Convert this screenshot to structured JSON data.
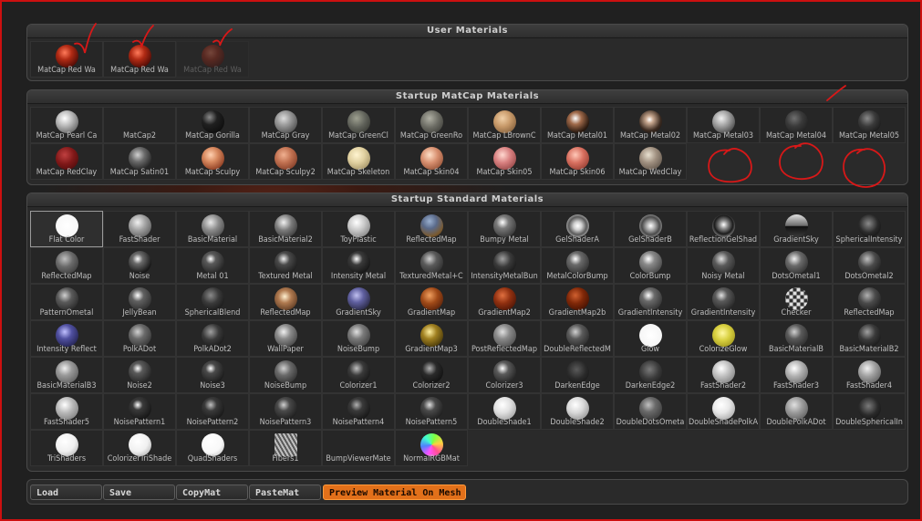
{
  "colors": {
    "frame_border": "#cc1010",
    "annotation": "#d81818",
    "preview_button": "#e2701a"
  },
  "user_materials": {
    "title": "User Materials",
    "items": [
      {
        "label": "MatCap  Red  Wa",
        "ball": "radial-gradient(circle at 40% 35%,#ff7a5a 0%,#b02a14 35%,#4a0a05 80%,#1a0000 100%)"
      },
      {
        "label": "MatCap  Red  Wa",
        "ball": "radial-gradient(circle at 40% 35%,#ff7a5a 0%,#b02a14 35%,#4a0a05 80%,#1a0000 100%)"
      },
      {
        "label": "MatCap  Red  Wa",
        "ball": "radial-gradient(circle at 40% 35%,#ff7a5a 0%,#b02a14 35%,#4a0a05 80%,#1a0000 100%)",
        "faded": true
      }
    ]
  },
  "startup_matcap": {
    "title": "Startup MatCap Materials",
    "items": [
      {
        "label": "MatCap  Pearl  Ca",
        "ball": "radial-gradient(circle at 40% 35%,#ffffff 0%,#c8c8c8 30%,#707070 75%,#303030 100%)"
      },
      {
        "label": "MatCap2",
        "ball": "radial-gradient(circle at 50% 50%,#262626 0%,#262626 100%)"
      },
      {
        "label": "MatCap  Gorilla",
        "ball": "radial-gradient(circle at 35% 30%,#8a8a8a 0%,#202020 35%,#050505 100%)"
      },
      {
        "label": "MatCap  Gray",
        "ball": "radial-gradient(circle at 40% 35%,#dcdcdc 0%,#9a9a9a 35%,#505050 80%,#262626 100%)"
      },
      {
        "label": "MatCap  GreenCl",
        "ball": "radial-gradient(circle at 40% 35%,#9ea090 0%,#60625a 45%,#2a2b26 100%)"
      },
      {
        "label": "MatCap  GreenRo",
        "ball": "radial-gradient(circle at 40% 35%,#b0b0a4 0%,#6c6c64 45%,#2e2e2a 100%)"
      },
      {
        "label": "MatCap  LBrownC",
        "ball": "radial-gradient(circle at 40% 35%,#f0d0a8 0%,#c89a6a 40%,#6a4a2a 100%)"
      },
      {
        "label": "MatCap  Metal01",
        "ball": "radial-gradient(circle at 40% 35%,#ffffff 0%,#a06a4a 30%,#2a1a10 70%,#101010 100%)"
      },
      {
        "label": "MatCap  Metal02",
        "ball": "radial-gradient(circle at 45% 40%,#ffffff 0%,#c8a890 20%,#3a2a20 60%,#0a0a0a 100%)"
      },
      {
        "label": "MatCap  Metal03",
        "ball": "radial-gradient(circle at 40% 35%,#f0f0f0 0%,#a8a8a8 35%,#4a4a4a 80%,#202020 100%)"
      },
      {
        "label": "MatCap  Metal04",
        "ball": "radial-gradient(circle at 40% 35%,#707070 0%,#3a3a3a 40%,#141414 100%)"
      },
      {
        "label": "MatCap  Metal05",
        "ball": "radial-gradient(circle at 40% 35%,#8a8a8a 0%,#3a3a3a 40%,#0a0a0a 100%)"
      },
      {
        "label": "MatCap  RedClay",
        "ball": "radial-gradient(circle at 40% 35%,#c04040 0%,#801818 45%,#3a0808 100%)"
      },
      {
        "label": "MatCap  Satin01",
        "ball": "radial-gradient(circle at 40% 35%,#d0d0d0 0%,#6a6a6a 35%,#202020 80%,#101010 100%)"
      },
      {
        "label": "MatCap  Sculpy",
        "ball": "radial-gradient(circle at 40% 35%,#ffd0b0 0%,#d88a60 35%,#8a3a20 80%,#3a1808 100%)"
      },
      {
        "label": "MatCap  Sculpy2",
        "ball": "radial-gradient(circle at 40% 35%,#f0b090 0%,#c07050 40%,#6a2a18 100%)"
      },
      {
        "label": "MatCap  Skeleton",
        "ball": "radial-gradient(circle at 40% 35%,#fff4d0 0%,#e0d0a0 40%,#8a7a50 100%)"
      },
      {
        "label": "MatCap  Skin04",
        "ball": "radial-gradient(circle at 40% 35%,#ffe0c8 0%,#d89070 40%,#7a3a20 100%)"
      },
      {
        "label": "MatCap  Skin05",
        "ball": "radial-gradient(circle at 40% 35%,#ffd8d0 0%,#d88080 40%,#7a3030 100%)"
      },
      {
        "label": "MatCap  Skin06",
        "ball": "radial-gradient(circle at 40% 35%,#ffc8b8 0%,#d87060 40%,#7a2a20 100%)"
      },
      {
        "label": "MatCap  WedClay",
        "ball": "radial-gradient(circle at 40% 35%,#e8e0d0 0%,#a09080 40%,#4a4038 100%)"
      }
    ]
  },
  "startup_standard": {
    "title": "Startup Standard Materials",
    "items": [
      {
        "label": "Flat  Color",
        "ball": "radial-gradient(circle,#ffffff 0%,#f4f4f4 100%)",
        "selected": true
      },
      {
        "label": "FastShader",
        "ball": "radial-gradient(circle at 40% 35%,#f0f0f0 0%,#a0a0a0 40%,#404040 100%)"
      },
      {
        "label": "BasicMaterial",
        "ball": "radial-gradient(circle at 40% 35%,#e8e8e8 0%,#8a8a8a 40%,#303030 100%)"
      },
      {
        "label": "BasicMaterial2",
        "ball": "radial-gradient(circle at 40% 35%,#f0f0f0 0%,#7a7a7a 40%,#202020 100%)"
      },
      {
        "label": "ToyPlastic",
        "ball": "radial-gradient(circle at 40% 35%,#ffffff 0%,#c8c8c8 40%,#6a6a6a 100%)"
      },
      {
        "label": "ReflectedMap",
        "ball": "radial-gradient(circle at 40% 30%,#9ab0d0 0%,#5a6a8a 35%,#7a5a30 70%,#2a1a10 100%)"
      },
      {
        "label": "Bumpy  Metal",
        "ball": "radial-gradient(circle at 40% 35%,#ffffff 0%,#7a7a7a 30%,#1a1a1a 100%)"
      },
      {
        "label": "GelShaderA",
        "ball": "radial-gradient(circle at 50% 50%,#ffffff 0%,#d0d0d0 25%,#5a5a5a 55%,#c0c0c0 80%,#303030 100%)"
      },
      {
        "label": "GelShaderB",
        "ball": "radial-gradient(circle at 50% 50%,#ffffff 0%,#b0b0b0 25%,#4a4a4a 55%,#a0a0a0 80%,#202020 100%)"
      },
      {
        "label": "ReflectionGelShad",
        "ball": "radial-gradient(circle at 50% 45%,#ffffff 0%,#8a8a8a 25%,#1a1a1a 55%,#9a9a9a 80%,#202020 100%)"
      },
      {
        "label": "GradientSky",
        "ball": "linear-gradient(#e0e0e0 0%,#6a6a6a 50%,#101010 52%,#3a3a3a 100%)"
      },
      {
        "label": "SphericalIntensity",
        "ball": "radial-gradient(circle at 45% 40%,#8a8a8a 0%,#2a2a2a 50%,#0a0a0a 100%)"
      },
      {
        "label": "ReflectedMap",
        "ball": "radial-gradient(circle at 40% 35%,#c0c0c0 0%,#6a6a6a 40%,#2a2a2a 100%)"
      },
      {
        "label": "Noise",
        "ball": "radial-gradient(circle at 40% 35%,#ffffff 0%,#6a6a6a 25%,#1a1a1a 70%,#0a0a0a 100%)"
      },
      {
        "label": "Metal  01",
        "ball": "radial-gradient(circle at 40% 35%,#ffffff 0%,#5a5a5a 25%,#0a0a0a 100%)"
      },
      {
        "label": "Textured  Metal",
        "ball": "radial-gradient(circle at 40% 35%,#f0f0f0 0%,#4a4a4a 30%,#080808 100%)"
      },
      {
        "label": "Intensity  Metal",
        "ball": "radial-gradient(circle at 40% 35%,#ffffff 0%,#3a3a3a 30%,#050505 100%)"
      },
      {
        "label": "TexturedMetal+C",
        "ball": "radial-gradient(circle at 40% 35%,#d0d0d0 0%,#5a5a5a 35%,#1a1a1a 100%)"
      },
      {
        "label": "IntensityMetalBun",
        "ball": "radial-gradient(circle at 40% 35%,#a0a0a0 0%,#3a3a3a 40%,#0a0a0a 100%)"
      },
      {
        "label": "MetalColorBump",
        "ball": "radial-gradient(circle at 40% 35%,#ffffff 0%,#6a6a6a 30%,#1a1a1a 100%)"
      },
      {
        "label": "ColorBump",
        "ball": "radial-gradient(circle at 40% 35%,#ffffff 0%,#8a8a8a 30%,#2a2a2a 100%)"
      },
      {
        "label": "Noisy  Metal",
        "ball": "radial-gradient(circle at 40% 35%,#e0e0e0 0%,#5a5a5a 35%,#1a1a1a 100%)"
      },
      {
        "label": "DotsOmetal1",
        "ball": "radial-gradient(circle at 40% 35%,#f0f0f0 0%,#6a6a6a 35%,#1a1a1a 100%)"
      },
      {
        "label": "DotsOmetal2",
        "ball": "radial-gradient(circle at 40% 35%,#c0c0c0 0%,#4a4a4a 40%,#101010 100%)"
      },
      {
        "label": "PatternOmetal",
        "ball": "radial-gradient(circle at 40% 35%,#d0d0d0 0%,#5a5a5a 35%,#151515 100%)"
      },
      {
        "label": "JellyBean",
        "ball": "radial-gradient(circle at 40% 35%,#ffffff 0%,#606060 30%,#1a1a1a 100%)"
      },
      {
        "label": "SphericalBlend",
        "ball": "radial-gradient(circle at 40% 35%,#8a8a8a 0%,#3a3a3a 40%,#0a0a0a 100%)"
      },
      {
        "label": "ReflectedMap",
        "ball": "radial-gradient(circle at 45% 40%,#fff0d0 0%,#b07a50 35%,#3a2010 100%)"
      },
      {
        "label": "GradientSky",
        "ball": "radial-gradient(circle at 40% 35%,#c0c0f0 0%,#6060a0 35%,#101018 100%)"
      },
      {
        "label": "GradientMap",
        "ball": "radial-gradient(circle at 40% 35%,#f0a060 0%,#a04a18 40%,#3a1005 100%)"
      },
      {
        "label": "GradientMap2",
        "ball": "radial-gradient(circle at 40% 35%,#e07040 0%,#903010 40%,#300a02 100%)"
      },
      {
        "label": "GradientMap2b",
        "ball": "radial-gradient(circle at 40% 35%,#d06030 0%,#802808 40%,#280800 100%)"
      },
      {
        "label": "GradientIntensity",
        "ball": "radial-gradient(circle at 40% 35%,#ffffff 0%,#6a6a6a 30%,#1a1a1a 100%)"
      },
      {
        "label": "GradientIntensity",
        "ball": "radial-gradient(circle at 40% 35%,#e0e0e0 0%,#5a5a5a 30%,#101010 100%)"
      },
      {
        "label": "Checker",
        "ball": "repeating-conic-gradient(#e0e0e0 0 25%,#303030 0 50%) 50%/8px 8px"
      },
      {
        "label": "ReflectedMap",
        "ball": "radial-gradient(circle at 40% 35%,#b0b0b0 0%,#4a4a4a 40%,#101010 100%)"
      },
      {
        "label": "Intensity  Reflect",
        "ball": "radial-gradient(circle at 40% 35%,#c0c0ff 0%,#5050a0 35%,#101030 100%)"
      },
      {
        "label": "PolkADot",
        "ball": "radial-gradient(circle at 40% 35%,#d0d0d0 0%,#6a6a6a 35%,#202020 100%)"
      },
      {
        "label": "PolkADot2",
        "ball": "radial-gradient(circle at 40% 35%,#a0a0a0 0%,#3a3a3a 40%,#0a0a0a 100%)"
      },
      {
        "label": "WallPaper",
        "ball": "radial-gradient(circle at 40% 35%,#f0f0f0 0%,#8a8a8a 35%,#2a2a2a 100%)"
      },
      {
        "label": "NoiseBump",
        "ball": "radial-gradient(circle at 40% 35%,#e0e0e0 0%,#7a7a7a 35%,#2a2a2a 100%)"
      },
      {
        "label": "GradientMap3",
        "ball": "radial-gradient(circle at 40% 35%,#fff0a0 0%,#a08020 35%,#201800 100%)"
      },
      {
        "label": "PostReflectedMap",
        "ball": "radial-gradient(circle at 40% 35%,#e0e0e0 0%,#8a8a8a 35%,#3a3a3a 100%)"
      },
      {
        "label": "DoubleReflectedM",
        "ball": "radial-gradient(circle at 40% 35%,#d0d0d0 0%,#5a5a5a 35%,#151515 100%)"
      },
      {
        "label": "Glow",
        "ball": "radial-gradient(circle,#ffffff 0%,#f4f4f4 80%,#c0c0c0 100%)"
      },
      {
        "label": "ColorizeGlow",
        "ball": "radial-gradient(circle at 45% 40%,#fff8a0 0%,#d8d040 40%,#8a8010 100%)"
      },
      {
        "label": "BasicMaterialB",
        "ball": "radial-gradient(circle at 40% 35%,#d0d0d0 0%,#5a5a5a 35%,#1a1a1a 100%)"
      },
      {
        "label": "BasicMaterialB2",
        "ball": "radial-gradient(circle at 40% 35%,#a0a0a0 0%,#3a3a3a 40%,#0a0a0a 100%)"
      },
      {
        "label": "BasicMaterialB3",
        "ball": "radial-gradient(circle at 40% 35%,#f0f0f0 0%,#9a9a9a 35%,#4a4a4a 100%)"
      },
      {
        "label": "Noise2",
        "ball": "radial-gradient(circle at 40% 35%,#ffffff 0%,#5a5a5a 25%,#0a0a0a 100%)"
      },
      {
        "label": "Noise3",
        "ball": "radial-gradient(circle at 40% 35%,#ffffff 0%,#4a4a4a 25%,#050505 100%)"
      },
      {
        "label": "NoiseBump",
        "ball": "radial-gradient(circle at 40% 35%,#d0d0d0 0%,#6a6a6a 35%,#1a1a1a 100%)"
      },
      {
        "label": "Colorizer1",
        "ball": "radial-gradient(circle at 40% 35%,#c0c0c0 0%,#3a3a3a 35%,#080808 100%)"
      },
      {
        "label": "Colorizer2",
        "ball": "radial-gradient(circle at 40% 35%,#b0b0b0 0%,#2a2a2a 35%,#050505 100%)"
      },
      {
        "label": "Colorizer3",
        "ball": "radial-gradient(circle at 40% 35%,#ffffff 0%,#5a5a5a 30%,#0a0a0a 100%)"
      },
      {
        "label": "DarkenEdge",
        "ball": "radial-gradient(circle at 45% 40%,#5a5a5a 0%,#2a2a2a 50%,#101010 100%)"
      },
      {
        "label": "DarkenEdge2",
        "ball": "radial-gradient(circle at 45% 40%,#7a7a7a 0%,#3a3a3a 50%,#151515 100%)"
      },
      {
        "label": "FastShader2",
        "ball": "radial-gradient(circle at 40% 35%,#ffffff 0%,#c0c0c0 40%,#6a6a6a 100%)"
      },
      {
        "label": "FastShader3",
        "ball": "radial-gradient(circle at 40% 35%,#ffffff 0%,#b0b0b0 40%,#5a5a5a 100%)"
      },
      {
        "label": "FastShader4",
        "ball": "radial-gradient(circle at 40% 35%,#f0f0f0 0%,#a0a0a0 40%,#4a4a4a 100%)"
      },
      {
        "label": "FastShader5",
        "ball": "radial-gradient(circle at 40% 35%,#ffffff 0%,#b8b8b8 40%,#6a6a6a 100%)"
      },
      {
        "label": "NoisePattern1",
        "ball": "radial-gradient(circle at 40% 35%,#ffffff 0%,#3a3a3a 25%,#050505 100%)"
      },
      {
        "label": "NoisePattern2",
        "ball": "radial-gradient(circle at 40% 35%,#c0c0c0 0%,#3a3a3a 30%,#080808 100%)"
      },
      {
        "label": "NoisePattern3",
        "ball": "radial-gradient(circle at 40% 35%,#d0d0d0 0%,#4a4a4a 30%,#0a0a0a 100%)"
      },
      {
        "label": "NoisePattern4",
        "ball": "radial-gradient(circle at 40% 35%,#b0b0b0 0%,#3a3a3a 30%,#060606 100%)"
      },
      {
        "label": "NoisePattern5",
        "ball": "radial-gradient(circle at 40% 35%,#e0e0e0 0%,#4a4a4a 30%,#0a0a0a 100%)"
      },
      {
        "label": "DoubleShade1",
        "ball": "radial-gradient(circle at 40% 35%,#ffffff 0%,#e0e0e0 40%,#8a8a8a 100%)"
      },
      {
        "label": "DoubleShade2",
        "ball": "radial-gradient(circle at 40% 35%,#ffffff 0%,#d8d8d8 40%,#7a7a7a 100%)"
      },
      {
        "label": "DoubleDotsOmeta",
        "ball": "radial-gradient(circle at 40% 35%,#c0c0c0 0%,#6a6a6a 35%,#2a2a2a 100%)"
      },
      {
        "label": "DoubleShadePolkA",
        "ball": "radial-gradient(circle at 40% 35%,#ffffff 0%,#e8e8e8 40%,#909090 100%)"
      },
      {
        "label": "DoublePolkADot",
        "ball": "radial-gradient(circle at 40% 35%,#e0e0e0 0%,#9a9a9a 40%,#4a4a4a 100%)"
      },
      {
        "label": "DoubleSphericalIn",
        "ball": "radial-gradient(circle at 45% 40%,#7a7a7a 0%,#2a2a2a 50%,#0a0a0a 100%)"
      },
      {
        "label": "TriShaders",
        "ball": "radial-gradient(circle at 40% 35%,#ffffff 0%,#f0f0f0 50%,#a0a0a0 100%)"
      },
      {
        "label": "ColorizerTriShade",
        "ball": "radial-gradient(circle at 40% 35%,#ffffff 0%,#f0f0f0 50%,#9a9a9a 100%)"
      },
      {
        "label": "QuadShaders",
        "ball": "radial-gradient(circle at 40% 35%,#ffffff 0%,#f8f8f8 55%,#b0b0b0 100%)"
      },
      {
        "label": "Fibers1",
        "ball": "repeating-linear-gradient(60deg,#c0c0c0 0 2px,#5a5a5a 2px 4px)",
        "square": true
      },
      {
        "label": "BumpViewerMate",
        "ball": "radial-gradient(circle,#262626 0%,#262626 100%)"
      },
      {
        "label": "NormalRGBMat",
        "ball": "conic-gradient(from 200deg,#ff50ff,#5080ff,#40ffd0,#80ff40,#ffd040,#ff5090,#ff50ff)"
      }
    ]
  },
  "toolbar": {
    "buttons": [
      {
        "label": "Load"
      },
      {
        "label": "Save"
      },
      {
        "label": "CopyMat"
      },
      {
        "label": "PasteMat"
      },
      {
        "label": "Preview  Material  On  Mesh",
        "active": true
      }
    ]
  }
}
